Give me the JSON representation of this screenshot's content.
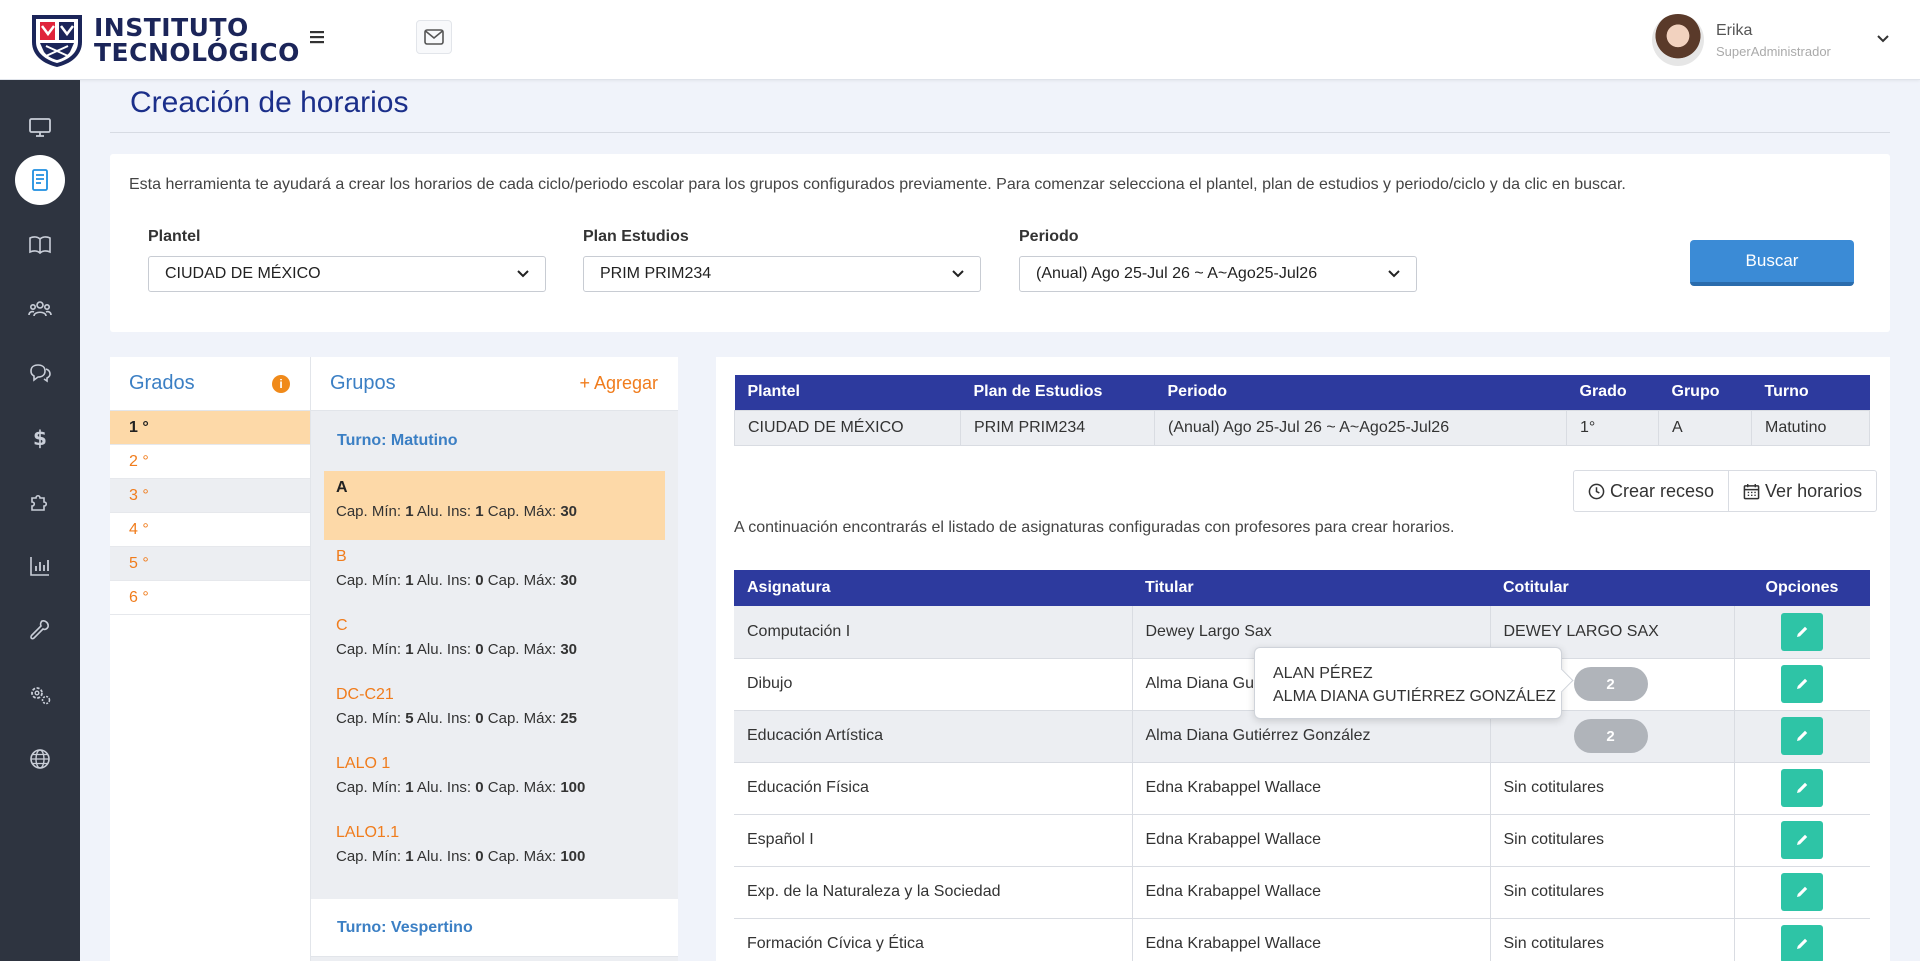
{
  "header": {
    "logo_line1": "INSTITUTO",
    "logo_line2": "TECNOLÓGICO",
    "user_name": "Erika",
    "user_role": "SuperAdministrador"
  },
  "sidebar": {
    "items": [
      {
        "icon": "monitor-icon"
      },
      {
        "icon": "document-icon",
        "active": true
      },
      {
        "icon": "book-open-icon"
      },
      {
        "icon": "users-icon"
      },
      {
        "icon": "chat-icon"
      },
      {
        "icon": "dollar-icon"
      },
      {
        "icon": "puzzle-icon"
      },
      {
        "icon": "bar-chart-icon"
      },
      {
        "icon": "wrench-icon"
      },
      {
        "icon": "gears-icon"
      },
      {
        "icon": "globe-icon"
      }
    ]
  },
  "page": {
    "title": "Creación de horarios"
  },
  "filters": {
    "description": "Esta herramienta te ayudará a crear los horarios de cada ciclo/periodo escolar para los grupos configurados previamente. Para comenzar selecciona el plantel, plan de estudios y periodo/ciclo y da clic en buscar.",
    "plantel_label": "Plantel",
    "plantel_value": "CIUDAD DE MÉXICO",
    "plan_label": "Plan Estudios",
    "plan_value": "PRIM PRIM234",
    "periodo_label": "Periodo",
    "periodo_value": "(Anual) Ago 25-Jul 26 ~ A~Ago25-Jul26",
    "search_label": "Buscar"
  },
  "grados": {
    "title": "Grados",
    "items": [
      "1 °",
      "2 °",
      "3 °",
      "4 °",
      "5 °",
      "6 °"
    ]
  },
  "grupos": {
    "title": "Grupos",
    "add_label": "+ Agregar",
    "turno_matutino": "Turno: Matutino",
    "turno_vespertino": "Turno: Vespertino",
    "cap_min_label": "Cap. Mín:",
    "alu_ins_label": "Alu. Ins:",
    "cap_max_label": "Cap. Máx:",
    "items": [
      {
        "name": "A",
        "cap_min": "1",
        "alu_ins": "1",
        "cap_max": "30"
      },
      {
        "name": "B",
        "cap_min": "1",
        "alu_ins": "0",
        "cap_max": "30"
      },
      {
        "name": "C",
        "cap_min": "1",
        "alu_ins": "0",
        "cap_max": "30"
      },
      {
        "name": "DC-C21",
        "cap_min": "5",
        "alu_ins": "0",
        "cap_max": "25"
      },
      {
        "name": "LALO 1",
        "cap_min": "1",
        "alu_ins": "0",
        "cap_max": "100"
      },
      {
        "name": "LALO1.1",
        "cap_min": "1",
        "alu_ins": "0",
        "cap_max": "100"
      }
    ]
  },
  "summary": {
    "headers": [
      "Plantel",
      "Plan de Estudios",
      "Periodo",
      "Grado",
      "Grupo",
      "Turno"
    ],
    "row": [
      "CIUDAD DE MÉXICO",
      "PRIM PRIM234",
      "(Anual) Ago 25-Jul 26 ~ A~Ago25-Jul26",
      "1°",
      "A",
      "Matutino"
    ]
  },
  "actions": {
    "crear_receso": "Crear receso",
    "ver_horarios": "Ver horarios"
  },
  "asignaturas": {
    "description": "A continuación encontrarás el listado de asignaturas configuradas con profesores para crear horarios.",
    "headers": [
      "Asignatura",
      "Titular",
      "Cotitular",
      "Opciones"
    ],
    "rows": [
      {
        "asignatura": "Computación I",
        "titular": "Dewey Largo Sax",
        "cotitular": "DEWEY LARGO SAX"
      },
      {
        "asignatura": "Dibujo",
        "titular": "Alma Diana Gutiérrez González",
        "cotitular": "2"
      },
      {
        "asignatura": "Educación Artística",
        "titular": "Alma Diana Gutiérrez González",
        "cotitular": "2"
      },
      {
        "asignatura": "Educación Física",
        "titular": "Edna Krabappel Wallace",
        "cotitular": "Sin cotitulares"
      },
      {
        "asignatura": "Español I",
        "titular": "Edna Krabappel Wallace",
        "cotitular": "Sin cotitulares"
      },
      {
        "asignatura": "Exp. de la Naturaleza y la Sociedad",
        "titular": "Edna Krabappel Wallace",
        "cotitular": "Sin cotitulares"
      },
      {
        "asignatura": "Formación Cívica y Ética",
        "titular": "Edna Krabappel Wallace",
        "cotitular": "Sin cotitulares"
      }
    ]
  },
  "tooltip": {
    "line1": "ALAN PÉREZ",
    "line2": "ALMA DIANA GUTIÉRREZ GONZÁLEZ"
  },
  "colors": {
    "primary_blue": "#2d3a9e",
    "accent_orange": "#f07c1c",
    "selected_bg": "#fdd9a8",
    "edit_green": "#2ec4a6",
    "search_btn": "#3b8bd6",
    "sidebar_bg": "#2e3440"
  }
}
